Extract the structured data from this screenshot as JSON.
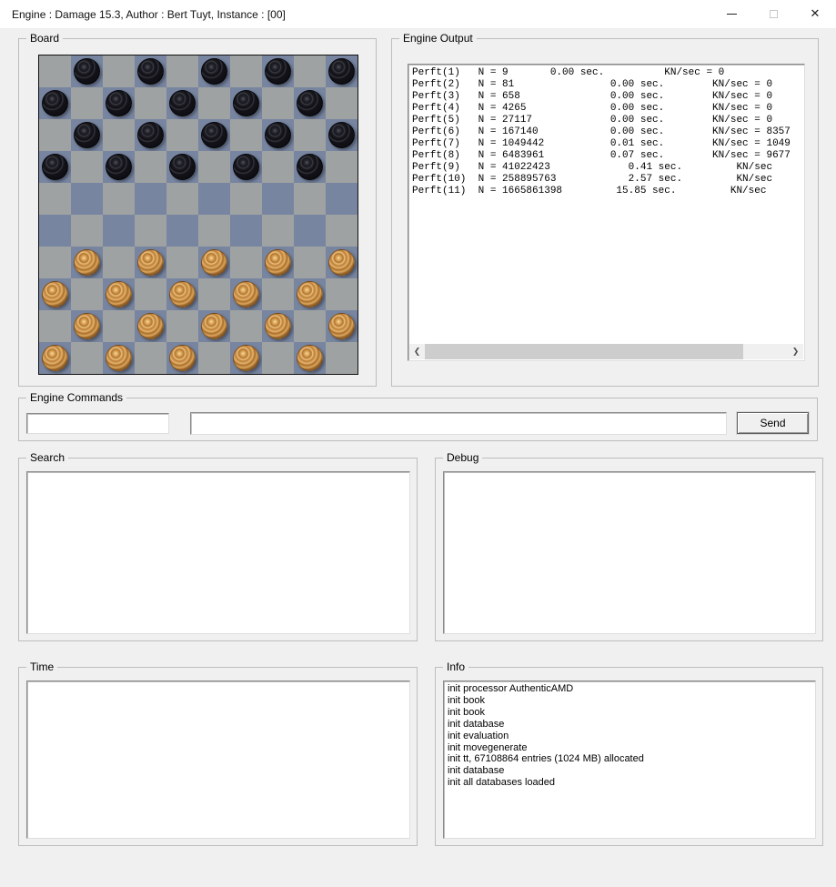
{
  "window": {
    "title": "Engine : Damage 15.3, Author : Bert Tuyt, Instance : [00]",
    "icons": {
      "minimize": "minimize-icon",
      "maximize": "maximize-icon",
      "close": "close-icon"
    },
    "close_glyph": "✕"
  },
  "groups": {
    "board": {
      "label": "Board"
    },
    "engine_output": {
      "label": "Engine Output"
    },
    "engine_commands": {
      "label": "Engine Commands"
    },
    "search": {
      "label": "Search"
    },
    "debug": {
      "label": "Debug"
    },
    "time": {
      "label": "Time"
    },
    "info": {
      "label": "Info"
    }
  },
  "engine_output": {
    "lines": [
      "Perft(1)   N = 9       0.00 sec.          KN/sec = 0",
      "Perft(2)   N = 81                0.00 sec.        KN/sec = 0",
      "Perft(3)   N = 658               0.00 sec.        KN/sec = 0",
      "Perft(4)   N = 4265              0.00 sec.        KN/sec = 0",
      "Perft(5)   N = 27117             0.00 sec.        KN/sec = 0",
      "Perft(6)   N = 167140            0.00 sec.        KN/sec = 8357",
      "Perft(7)   N = 1049442           0.01 sec.        KN/sec = 1049",
      "Perft(8)   N = 6483961           0.07 sec.        KN/sec = 9677",
      "Perft(9)   N = 41022423             0.41 sec.         KN/sec",
      "Perft(10)  N = 258895763            2.57 sec.         KN/sec",
      "Perft(11)  N = 1665861398         15.85 sec.         KN/sec"
    ],
    "scrollbar": {
      "left_arrow": "❮",
      "right_arrow": "❯"
    }
  },
  "engine_commands": {
    "command_input": {
      "value": "",
      "placeholder": ""
    },
    "args_input": {
      "value": "",
      "placeholder": ""
    },
    "send_label": "Send"
  },
  "search": {
    "content": ""
  },
  "debug": {
    "content": ""
  },
  "time": {
    "content": ""
  },
  "info": {
    "lines": [
      "init processor AuthenticAMD",
      "init book",
      "init book",
      "init database",
      "init evaluation",
      "init movegenerate",
      "init tt, 67108864 entries (1024 MB) allocated",
      "init database",
      "init all databases loaded"
    ]
  },
  "board": {
    "rows": 10,
    "cols": 10,
    "grid": [
      ".b.b.b.b.b",
      "b.b.b.b.b.",
      ".b.b.b.b.b",
      "b.b.b.b.b.",
      "..........",
      "..........",
      ".w.w.w.w.w",
      "w.w.w.w.w.",
      ".w.w.w.w.w",
      "w.w.w.w.w."
    ],
    "colors": {
      "light_square": "#9fa2a2",
      "dark_square": "#7785a1",
      "black_piece": "#15151b",
      "white_piece": "#cf9a52"
    }
  }
}
